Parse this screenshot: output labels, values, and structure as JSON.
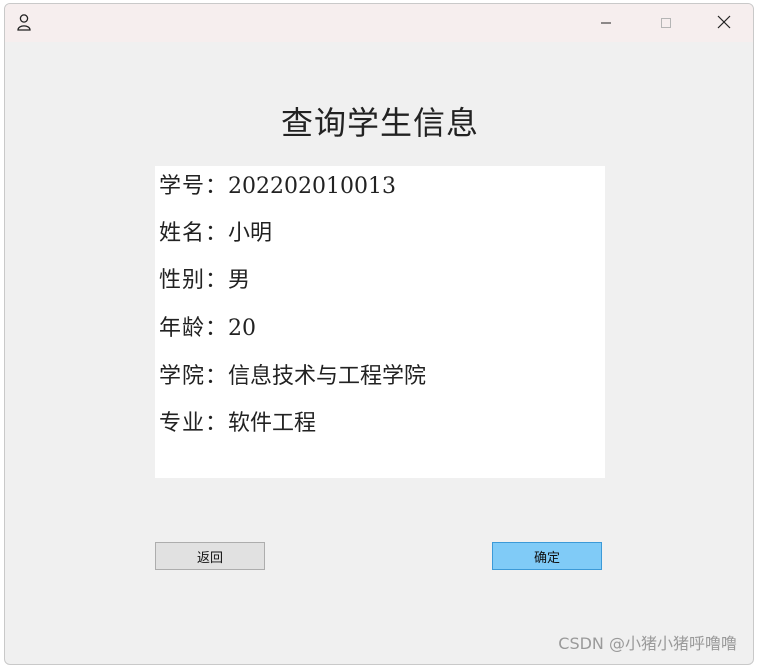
{
  "window": {
    "app_icon": "user-icon",
    "controls": {
      "minimize": "minimize-icon",
      "maximize": "maximize-icon",
      "close": "close-icon"
    }
  },
  "main": {
    "heading": "查询学生信息",
    "fields": [
      {
        "label": "学号：",
        "value": "202202010013"
      },
      {
        "label": "姓名：",
        "value": "小明"
      },
      {
        "label": "性别：",
        "value": "男"
      },
      {
        "label": "年龄：",
        "value": "20"
      },
      {
        "label": "学院：",
        "value": "信息技术与工程学院"
      },
      {
        "label": "专业：",
        "value": "软件工程"
      }
    ]
  },
  "buttons": {
    "back_label": "返回",
    "confirm_label": "确定"
  },
  "watermark": "CSDN @小猪小猪呼噜噜",
  "colors": {
    "window_bg": "#f0f0f0",
    "titlebar_bg": "#f6eeee",
    "confirm_bg": "#80cbf7",
    "back_bg": "#e1e1e1"
  }
}
